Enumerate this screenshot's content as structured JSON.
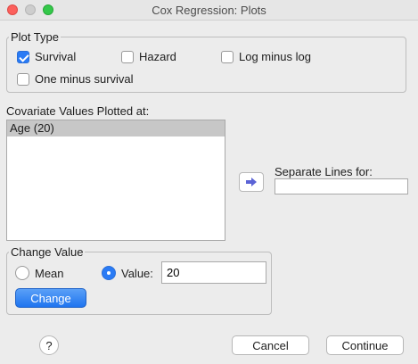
{
  "window": {
    "title": "Cox Regression: Plots"
  },
  "plot_type": {
    "legend": "Plot Type",
    "options": [
      {
        "label": "Survival",
        "checked": true
      },
      {
        "label": "Hazard",
        "checked": false
      },
      {
        "label": "Log minus log",
        "checked": false
      },
      {
        "label": "One minus survival",
        "checked": false
      }
    ]
  },
  "covariates": {
    "label": "Covariate Values Plotted at:",
    "items": [
      "Age (20)"
    ]
  },
  "move_button": {
    "icon": "arrow-right-icon"
  },
  "separate_lines": {
    "label": "Separate Lines for:",
    "value": ""
  },
  "change_value": {
    "legend": "Change Value",
    "mean_label": "Mean",
    "value_label": "Value:",
    "value": "20",
    "selected": "value",
    "change_label": "Change"
  },
  "footer": {
    "help_label": "?",
    "cancel_label": "Cancel",
    "continue_label": "Continue"
  },
  "colors": {
    "accent": "#2a7bf5",
    "selection": "#c7c7c7"
  }
}
